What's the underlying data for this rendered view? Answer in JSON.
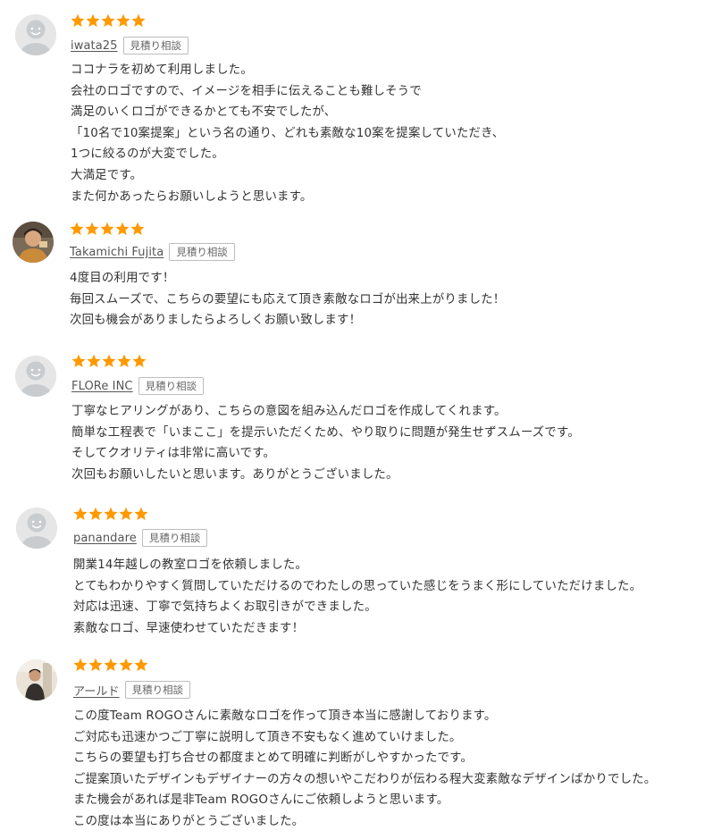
{
  "colors": {
    "star": "#ff9900",
    "text": "#333333",
    "border": "#bdbdbd",
    "default_avatar": "#cfd2d4"
  },
  "estimate_label": "見積り相談",
  "rating_max": 5,
  "reviews": [
    {
      "username": "iwata25",
      "rating": 5,
      "avatar": "default-avatar-icon",
      "lines": [
        "ココナラを初めて利用しました。",
        "会社のロゴですので、イメージを相手に伝えることも難しそうで",
        "満足のいくロゴができるかとても不安でしたが、",
        "「10名で10案提案」という名の通り、どれも素敵な10案を提案していただき、",
        "1つに絞るのが大変でした。",
        "大満足です。",
        "また何かあったらお願いしようと思います。"
      ]
    },
    {
      "username": "Takamichi Fujita",
      "rating": 5,
      "avatar": "user-photo-icon",
      "lines": [
        "4度目の利用です！",
        "毎回スムーズで、こちらの要望にも応えて頂き素敵なロゴが出来上がりました！",
        "次回も機会がありましたらよろしくお願い致します！"
      ]
    },
    {
      "username": "FLORe INC",
      "rating": 5,
      "avatar": "default-avatar-icon",
      "lines": [
        "丁寧なヒアリングがあり、こちらの意図を組み込んだロゴを作成してくれます。",
        "簡単な工程表で「いまここ」を提示いただくため、やり取りに問題が発生せずスムーズです。",
        "そしてクオリティは非常に高いです。",
        "次回もお願いしたいと思います。ありがとうございました。"
      ]
    },
    {
      "username": "panandare",
      "rating": 5,
      "avatar": "default-avatar-icon",
      "lines": [
        "開業14年越しの教室ロゴを依頼しました。",
        "とてもわかりやすく質問していただけるのでわたしの思っていた感じをうまく形にしていただけました。",
        "対応は迅速、丁寧で気持ちよくお取引きができました。",
        "素敵なロゴ、早速使わせていただきます！"
      ]
    },
    {
      "username": "アールド",
      "rating": 5,
      "avatar": "user-photo-icon",
      "lines": [
        "この度Team ROGOさんに素敵なロゴを作って頂き本当に感謝しております。",
        "ご対応も迅速かつご丁寧に説明して頂き不安もなく進めていけました。",
        "こちらの要望も打ち合せの都度まとめて明確に判断がしやすかったです。",
        "ご提案頂いたデザインもデザイナーの方々の想いやこだわりが伝わる程大変素敵なデザインばかりでした。",
        "また機会があれば是非Team ROGOさんにご依頼しようと思います。",
        "この度は本当にありがとうございました。"
      ]
    }
  ]
}
